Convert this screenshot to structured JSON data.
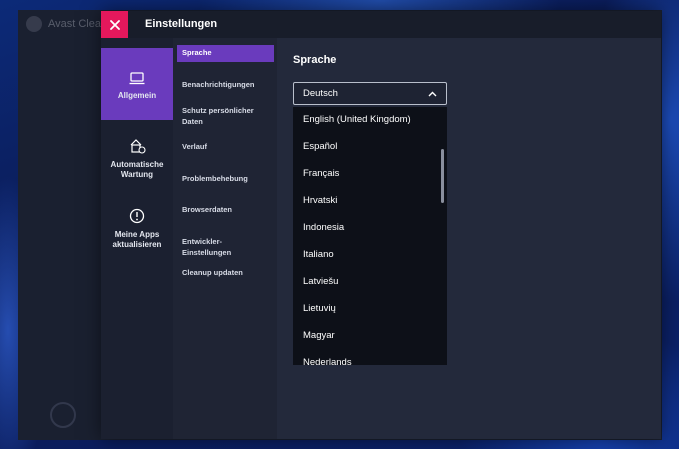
{
  "background_app": {
    "title": "Avast Cleanup"
  },
  "dialog": {
    "title": "Einstellungen",
    "close_icon": "close-icon"
  },
  "rail": {
    "items": [
      {
        "label": "Allgemein",
        "icon": "monitor-icon",
        "active": true
      },
      {
        "label": "Automatische Wartung",
        "icon": "maintenance-icon",
        "active": false
      },
      {
        "label": "Meine Apps aktualisieren",
        "icon": "alert-icon",
        "active": false
      }
    ]
  },
  "subnav": {
    "items": [
      {
        "label": "Sprache",
        "active": true
      },
      {
        "label": "Benachrichtigungen"
      },
      {
        "label": "Schutz persönlicher Daten"
      },
      {
        "label": "Verlauf"
      },
      {
        "label": "Problembehebung"
      },
      {
        "label": "Browserdaten"
      },
      {
        "label": "Entwickler-Einstellungen"
      },
      {
        "label": "Cleanup updaten"
      }
    ]
  },
  "content": {
    "title": "Sprache",
    "language_select": {
      "selected": "Deutsch",
      "options": [
        "English (United Kingdom)",
        "Español",
        "Français",
        "Hrvatski",
        "Indonesia",
        "Italiano",
        "Latviešu",
        "Lietuvių",
        "Magyar",
        "Nederlands"
      ]
    }
  },
  "colors": {
    "accent": "#6a3bbd",
    "close": "#e4185c",
    "dialog_bg": "#23293b",
    "dropdown_bg": "#0d1018"
  }
}
